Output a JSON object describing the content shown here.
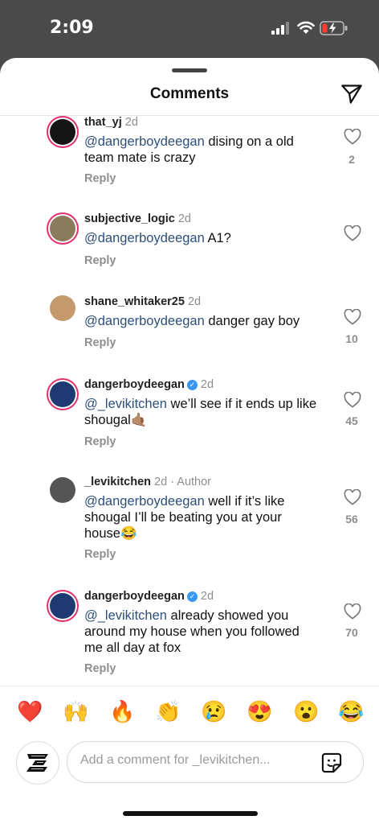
{
  "status_bar": {
    "time": "2:09"
  },
  "sheet": {
    "title": "Comments",
    "send_icon": "paper-plane-icon"
  },
  "comments": [
    {
      "username": "that_yj",
      "time": "2d",
      "mention": "@dangerboydeegan",
      "text": " dising on a old team mate is crazy",
      "reply": "Reply",
      "likes": "2",
      "avatar_color": "#1a1a1a",
      "ring": true,
      "verified": false
    },
    {
      "username": "subjective_logic",
      "time": "2d",
      "mention": "@dangerboydeegan",
      "text": " A1?",
      "reply": "Reply",
      "likes": "",
      "avatar_color": "#8a7b5c",
      "ring": true,
      "verified": false
    },
    {
      "username": "shane_whitaker25",
      "time": "2d",
      "mention": "@dangerboydeegan",
      "text": " danger gay boy",
      "reply": "Reply",
      "likes": "10",
      "avatar_color": "#c49a6c",
      "ring": false,
      "verified": false
    },
    {
      "username": "dangerboydeegan",
      "time": "2d",
      "mention": "@_levikitchen",
      "text": " we’ll see if it ends up like shougal🤙🏽",
      "reply": "Reply",
      "likes": "45",
      "avatar_color": "#1f3a73",
      "ring": true,
      "verified": true
    },
    {
      "username": "_levikitchen",
      "time": "2d",
      "author_tag": "Author",
      "mention": "@dangerboydeegan",
      "text": " well if it’s like shougal I’ll be beating you at your house😂",
      "reply": "Reply",
      "likes": "56",
      "avatar_color": "#555555",
      "ring": false,
      "verified": false
    },
    {
      "username": "dangerboydeegan",
      "time": "2d",
      "mention": "@_levikitchen",
      "text": " already showed you around my house when you followed me all day at fox",
      "reply": "Reply",
      "likes": "70",
      "avatar_color": "#1f3a73",
      "ring": true,
      "verified": true
    }
  ],
  "quick_reactions": [
    "❤️",
    "🙌",
    "🔥",
    "👏",
    "😢",
    "😍",
    "😮",
    "😂"
  ],
  "composer": {
    "placeholder": "Add a comment for _levikitchen...",
    "sticker_icon": "sticker-icon"
  },
  "colors": {
    "mention": "#2d4f7a",
    "meta": "#8e8e8e",
    "verified": "#3897f0",
    "story_ring": "#e1306c"
  }
}
